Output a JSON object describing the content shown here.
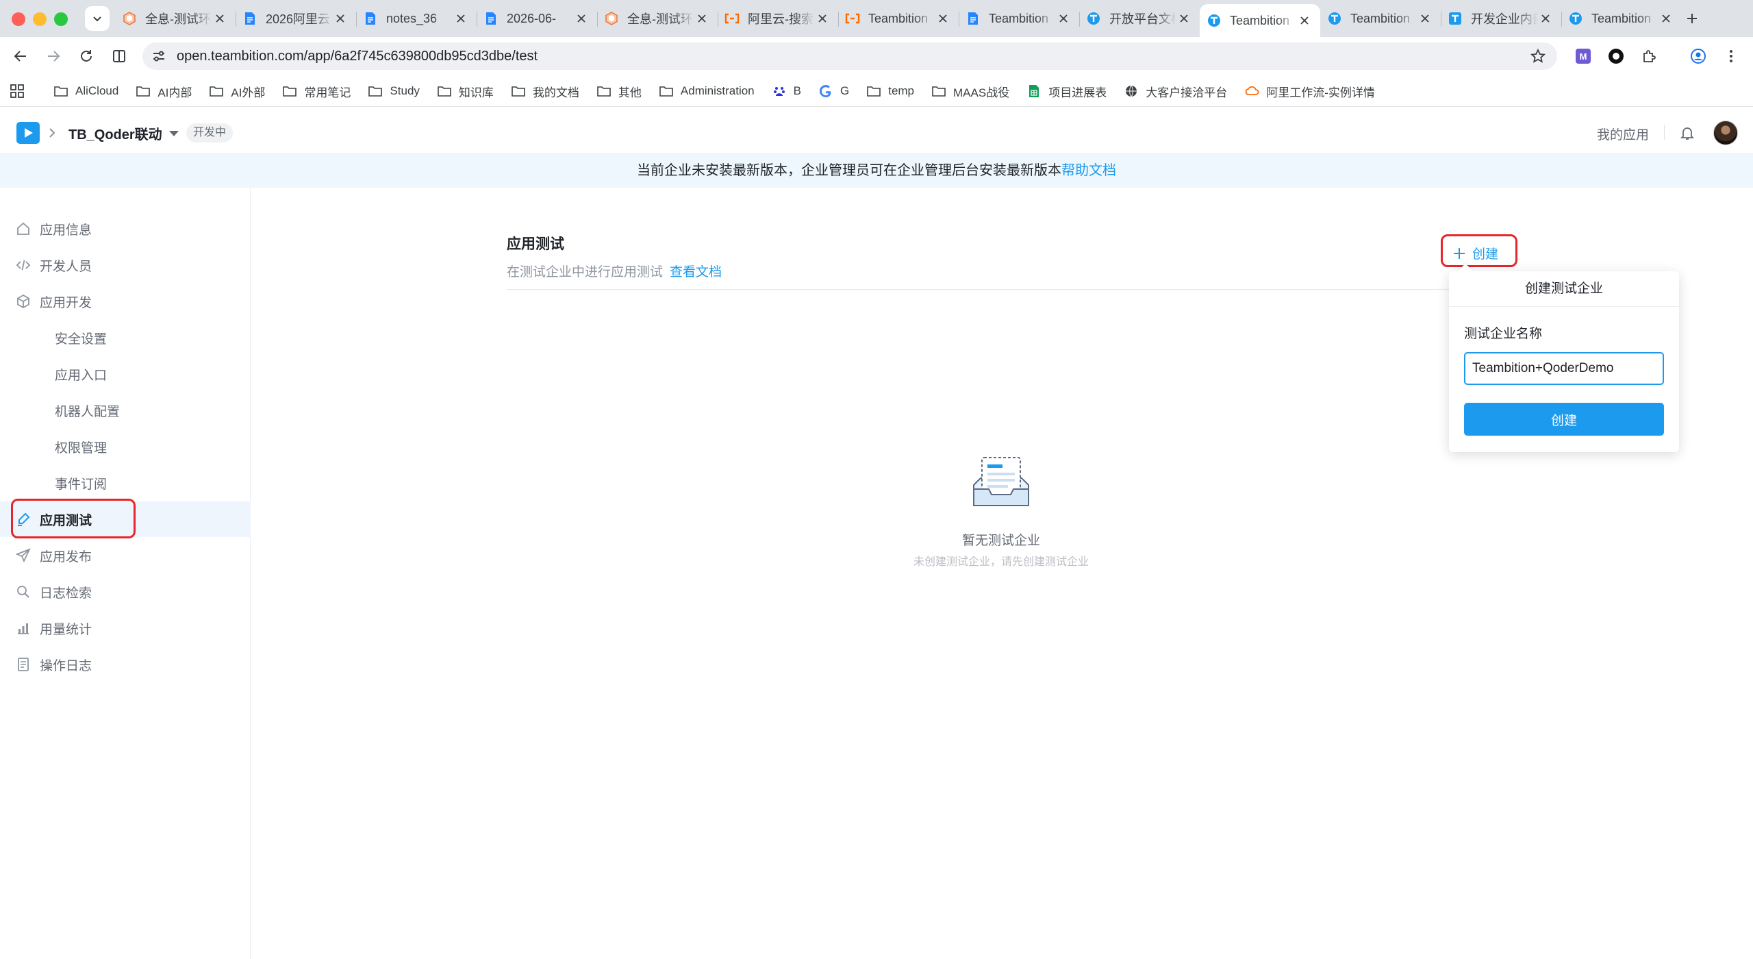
{
  "browser": {
    "tabs": [
      {
        "title": "全息-测试环境",
        "favicon": "hexagon-orange-icon"
      },
      {
        "title": "2026阿里云",
        "favicon": "doc-blue-icon"
      },
      {
        "title": "notes_36",
        "favicon": "doc-blue-icon"
      },
      {
        "title": "2026-06-",
        "favicon": "doc-blue-icon"
      },
      {
        "title": "全息-测试环境",
        "favicon": "hexagon-orange-icon"
      },
      {
        "title": "阿里云-搜索",
        "favicon": "aliyun-orange-icon"
      },
      {
        "title": "Teambition",
        "favicon": "aliyun-orange-icon"
      },
      {
        "title": "Teambition",
        "favicon": "doc-blue-icon"
      },
      {
        "title": "开放平台文档",
        "favicon": "teambition-icon"
      },
      {
        "title": "Teambition",
        "favicon": "teambition-icon",
        "active": true
      },
      {
        "title": "Teambition",
        "favicon": "teambition-icon"
      },
      {
        "title": "开发企业内部应用",
        "favicon": "teambition-doc-icon"
      },
      {
        "title": "Teambition",
        "favicon": "teambition-icon"
      }
    ],
    "url": "open.teambition.com/app/6a2f745c639800db95cd3dbe/test",
    "bookmarks": [
      {
        "label": "AliCloud",
        "icon": "folder-icon"
      },
      {
        "label": "AI内部",
        "icon": "folder-icon"
      },
      {
        "label": "AI外部",
        "icon": "folder-icon"
      },
      {
        "label": "常用笔记",
        "icon": "folder-icon"
      },
      {
        "label": "Study",
        "icon": "folder-icon"
      },
      {
        "label": "知识库",
        "icon": "folder-icon"
      },
      {
        "label": "我的文档",
        "icon": "folder-icon"
      },
      {
        "label": "其他",
        "icon": "folder-icon"
      },
      {
        "label": "Administration",
        "icon": "folder-icon"
      },
      {
        "label": "B",
        "icon": "baidu-icon"
      },
      {
        "label": "G",
        "icon": "google-icon"
      },
      {
        "label": "temp",
        "icon": "folder-icon"
      },
      {
        "label": "MAAS战役",
        "icon": "folder-icon"
      },
      {
        "label": "项目进展表",
        "icon": "sheet-icon"
      },
      {
        "label": "大客户接洽平台",
        "icon": "globe-icon"
      },
      {
        "label": "阿里工作流-实例详情",
        "icon": "aliyun-orange-icon"
      }
    ]
  },
  "header": {
    "app_name": "TB_Qoder联动",
    "status_badge": "开发中",
    "my_apps": "我的应用"
  },
  "notice": {
    "text": "当前企业未安装最新版本，企业管理员可在企业管理后台安装最新版本",
    "link": "帮助文档"
  },
  "sidebar": {
    "items": [
      {
        "label": "应用信息",
        "icon": "home-icon"
      },
      {
        "label": "开发人员",
        "icon": "code-icon"
      },
      {
        "label": "应用开发",
        "icon": "cube-icon"
      },
      {
        "label": "安全设置"
      },
      {
        "label": "应用入口"
      },
      {
        "label": "机器人配置"
      },
      {
        "label": "权限管理"
      },
      {
        "label": "事件订阅"
      },
      {
        "label": "应用测试",
        "icon": "test-brush-icon",
        "active": true
      },
      {
        "label": "应用发布",
        "icon": "send-icon"
      },
      {
        "label": "日志检索",
        "icon": "search-icon"
      },
      {
        "label": "用量统计",
        "icon": "bar-chart-icon"
      },
      {
        "label": "操作日志",
        "icon": "log-icon"
      }
    ]
  },
  "main": {
    "title": "应用测试",
    "description": "在测试企业中进行应用测试",
    "doc_link": "查看文档",
    "create_label": "创建",
    "empty_title": "暂无测试企业",
    "empty_desc": "未创建测试企业，请先创建测试企业"
  },
  "popover": {
    "title": "创建测试企业",
    "field_label": "测试企业名称",
    "field_value": "Teambition+QoderDemo",
    "submit": "创建"
  },
  "colors": {
    "accent": "#1b9aee",
    "highlight_red": "#e5262a",
    "notice_bg": "#eef7fd"
  }
}
